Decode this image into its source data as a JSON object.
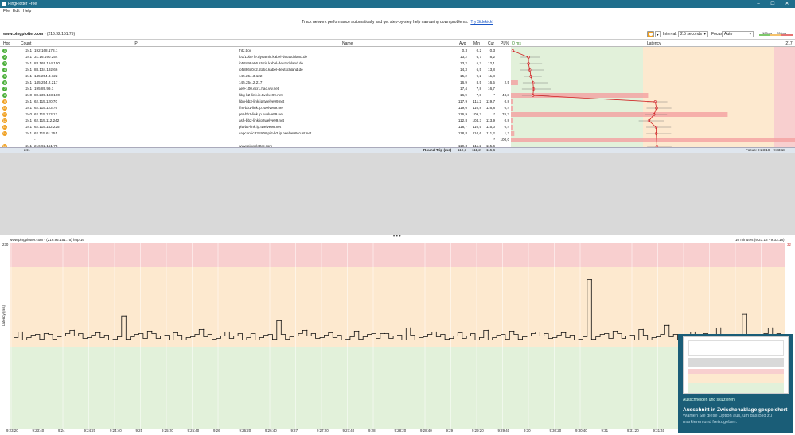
{
  "window": {
    "title": "PingPlotter Free",
    "minimize": "–",
    "maximize": "☐",
    "close": "✕",
    "bar_color": "#1f6e8c"
  },
  "menu": [
    "File",
    "Edit",
    "Help"
  ],
  "promo": {
    "text": "Track network performance automatically and get step-by-step help narrowing down problems.",
    "link": "Try Sidekick!"
  },
  "target": {
    "host": "www.pingplotter.com",
    "ip": " - (216.92.151.75)"
  },
  "controls": {
    "interval_label": "Interval:",
    "interval_value": "2.5 seconds",
    "focus_label": "Focus:",
    "focus_value": "Auto",
    "thr_100": "100ms",
    "thr_200": "200ms"
  },
  "table": {
    "headers": {
      "hop": "Hop",
      "count": "Count",
      "ip": "IP",
      "name": "Name",
      "avg": "Avg",
      "min": "Min",
      "cur": "Cur",
      "pl": "PL%",
      "lat0": "0 ms",
      "latency": "Latency",
      "latmax": "217 ms"
    },
    "rows": [
      {
        "hop": "1",
        "count": "241",
        "ip": "192.168.178.1",
        "name": "fritz.box",
        "avg": "0,3",
        "min": "0,2",
        "cur": "0,3",
        "pl": "",
        "color": "#4caf3a"
      },
      {
        "hop": "2",
        "count": "241",
        "ip": "31.16.190.254",
        "name": "ip1f10be fe.dynamic.kabel-deutschland.de",
        "avg": "13,2",
        "min": "6,7",
        "cur": "8,2",
        "pl": "",
        "color": "#4caf3a"
      },
      {
        "hop": "3",
        "count": "241",
        "ip": "83.169.154.150",
        "name": "ip53a99a96.static.kabel-deutschland.de",
        "avg": "13,2",
        "min": "5,7",
        "cur": "12,1",
        "pl": "",
        "color": "#4caf3a"
      },
      {
        "hop": "4",
        "count": "241",
        "ip": "88.134.192.66",
        "name": "ip5886c042.static.kabel-deutschland.de",
        "avg": "14,3",
        "min": "6,5",
        "cur": "13,8",
        "pl": "",
        "color": "#4caf3a"
      },
      {
        "hop": "5",
        "count": "241",
        "ip": "145.254.3.122",
        "name": "145.254.3.122",
        "avg": "15,2",
        "min": "9,2",
        "cur": "11,8",
        "pl": "",
        "color": "#4caf3a"
      },
      {
        "hop": "6",
        "count": "241",
        "ip": "145.254.2.217",
        "name": "145.254.2.217",
        "avg": "16,9",
        "min": "8,5",
        "cur": "16,5",
        "pl": "2,5",
        "color": "#4caf3a"
      },
      {
        "hop": "7",
        "count": "241",
        "ip": "195.89.99.1",
        "name": "ae9-100.ecr1.hac.vw.net",
        "avg": "17,4",
        "min": "7,8",
        "cur": "16,7",
        "pl": "",
        "color": "#4caf3a"
      },
      {
        "hop": "8",
        "count": "240",
        "ip": "80.239.193.100",
        "name": "hbg-b2-link.ip.twelve99.net",
        "avg": "16,9",
        "min": "7,8",
        "cur": "*",
        "pl": "48,3",
        "color": "#4caf3a"
      },
      {
        "hop": "9",
        "count": "241",
        "ip": "62.115.120.70",
        "name": "hbg-bb3-link.ip.twelve99.net",
        "avg": "117,9",
        "min": "111,2",
        "cur": "119,7",
        "pl": "0,8",
        "color": "#f0a020"
      },
      {
        "hop": "10",
        "count": "241",
        "ip": "62.115.123.76",
        "name": "ffm-bb1-link.ip.twelve99.net",
        "avg": "119,0",
        "min": "110,8",
        "cur": "116,8",
        "pl": "0,4",
        "color": "#f0a020"
      },
      {
        "hop": "11",
        "count": "240",
        "ip": "62.115.123.13",
        "name": "prs-bb1-link.ip.twelve99.net",
        "avg": "116,9",
        "min": "109,7",
        "cur": "*",
        "pl": "76,3",
        "color": "#f0a020"
      },
      {
        "hop": "12",
        "count": "241",
        "ip": "62.115.112.242",
        "name": "ash-bb2-link.ip.twelve99.net",
        "avg": "112,8",
        "min": "104,3",
        "cur": "113,9",
        "pl": "0,8",
        "color": "#f0a020"
      },
      {
        "hop": "13",
        "count": "241",
        "ip": "62.115.142.225",
        "name": "pitt-b2-link.ip.twelve99.net",
        "avg": "118,7",
        "min": "110,5",
        "cur": "115,0",
        "pl": "0,4",
        "color": "#f0a020"
      },
      {
        "hop": "14",
        "count": "241",
        "ip": "62.115.61.251",
        "name": "capcon-ic331908-pitt-b2.ip.twelve99-cust.net",
        "avg": "118,8",
        "min": "110,6",
        "cur": "111,2",
        "pl": "1,2",
        "color": "#f0a020"
      },
      {
        "hop": "",
        "count": "",
        "ip": "-",
        "name": "",
        "avg": "",
        "min": "",
        "cur": "*",
        "pl": "100,0",
        "color": ""
      },
      {
        "hop": "16",
        "count": "241",
        "ip": "216.92.151.75",
        "name": "www.pingplotter.com",
        "avg": "119,3",
        "min": "111,2",
        "cur": "115,6",
        "pl": "",
        "color": "#f0a020"
      }
    ],
    "footer": {
      "count": "241",
      "label": "Round Trip (ms)",
      "avg": "119,3",
      "min": "111,2",
      "cur": "115,6",
      "focus": "Focus: 9:23:18 - 9:33:18"
    }
  },
  "graph": {
    "title": "www.pingplotter.com - (216.92.151.75) hop 16",
    "range": "10 minutes (9:23:18 - 9:33:18)",
    "ylabel": "Latency (ms)",
    "ymax_label": "230",
    "right_label": "32",
    "xticks": [
      "9:23:20",
      "9:23:40",
      "9:24",
      "9:24:20",
      "9:24:40",
      "9:25",
      "9:25:20",
      "9:25:40",
      "9:26",
      "9:26:20",
      "9:26:40",
      "9:27",
      "9:27:20",
      "9:27:40",
      "9:28",
      "9:28:20",
      "9:28:40",
      "9:29",
      "9:29:20",
      "9:29:40",
      "9:30",
      "9:30:20",
      "9:30:40",
      "9:31",
      "9:31:20",
      "9:31:40",
      "9:32",
      "9:32:20",
      "9:32:40",
      "9:33"
    ],
    "zones": {
      "red": "#f8cfcf",
      "orange": "#fde9cf",
      "green": "#e2f1da"
    }
  },
  "chart_data": {
    "type": "line",
    "ylabel": "Latency (ms)",
    "ylim": [
      0,
      230
    ],
    "x": [
      "9:23:20",
      "9:23:40",
      "9:24",
      "9:24:20",
      "9:24:40",
      "9:25",
      "9:25:20",
      "9:25:40",
      "9:26",
      "9:26:20",
      "9:26:40",
      "9:27",
      "9:27:20",
      "9:27:40",
      "9:28",
      "9:28:20",
      "9:28:40",
      "9:29",
      "9:29:20",
      "9:29:40",
      "9:30",
      "9:30:20",
      "9:30:40",
      "9:31",
      "9:31:20",
      "9:31:40",
      "9:32",
      "9:32:20",
      "9:32:40",
      "9:33"
    ],
    "series": [
      {
        "values": [
          120,
          118,
          122,
          119,
          140,
          121,
          119,
          123,
          120,
          118,
          134,
          122,
          119,
          121,
          118,
          125,
          120,
          119,
          122,
          121,
          120,
          119,
          185,
          121,
          123,
          128,
          120,
          125,
          142,
          125
        ]
      }
    ]
  },
  "toast": {
    "source": "Ausschneiden und skizzieren",
    "title": "Ausschnitt in Zwischenablage gespeichert",
    "body": "Wählen Sie diese Option aus, um das Bild zu markieren und freizugeben."
  }
}
